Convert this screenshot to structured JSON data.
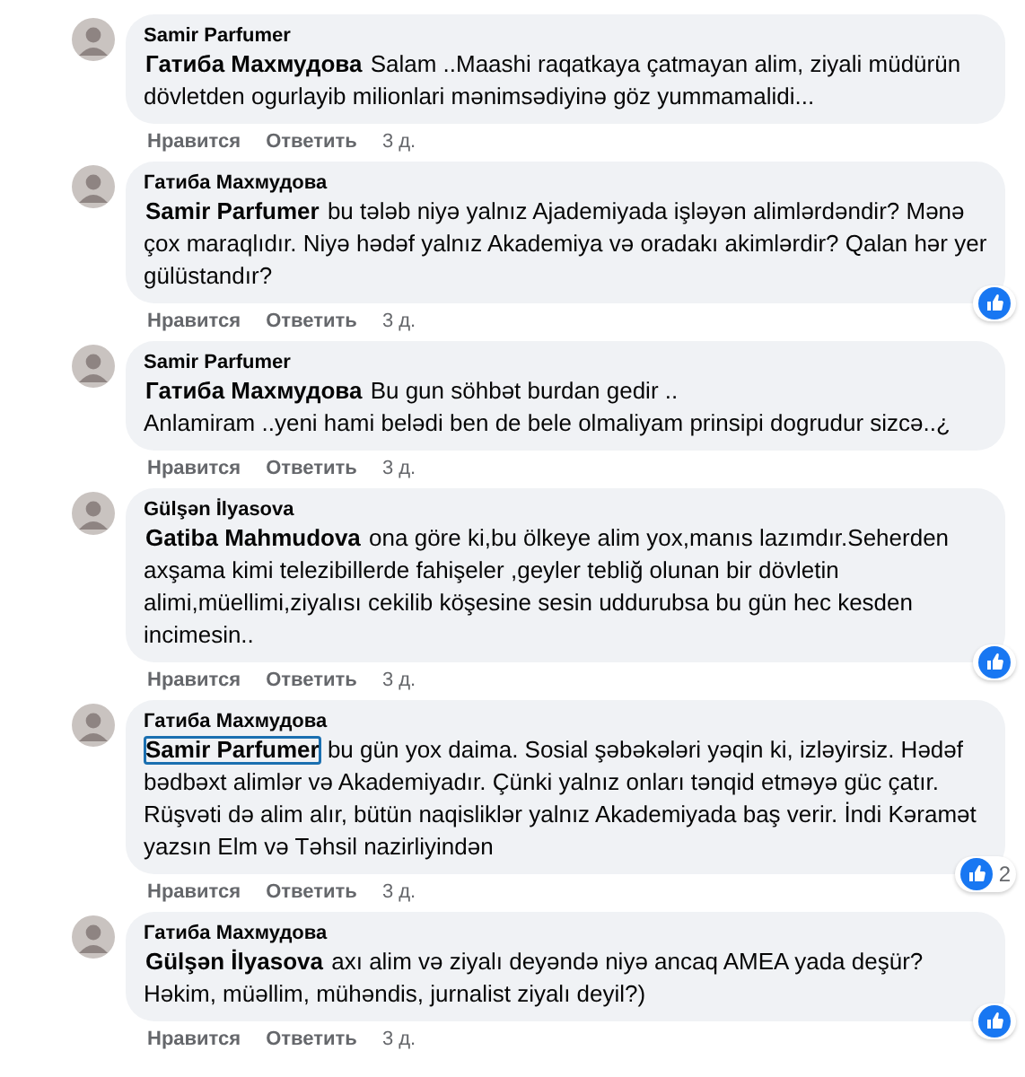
{
  "comments": [
    {
      "author": "Samir Parfumer",
      "mention": "Гатиба Махмудова",
      "mention_focused": false,
      "text": "Salam ..Maashi raqatkaya çatmayan alim, ziyali müdürün dövletden ogurlayib milionlari mənimsədiyinə göz yummamalidi...",
      "liked": false,
      "actions": [
        "Нравится",
        "Ответить"
      ],
      "time": "3 д."
    },
    {
      "author": "Гатиба Махмудова",
      "mention": "Samir Parfumer",
      "mention_focused": false,
      "text": "bu tələb niyə yalnız Ajademiyada işləyən alimlərdəndir? Mənə çox maraqlıdır. Niyə hədəf yalnız Akademiya və oradakı akimlərdir? Qalan hər yer gülüstandır?",
      "liked": true,
      "actions": [
        "Нравится",
        "Ответить"
      ],
      "time": "3 д."
    },
    {
      "author": "Samir Parfumer",
      "mention": "Гатиба Махмудова",
      "mention_focused": false,
      "text": "Bu gun söhbət burdan gedir ..\nAnlamiram ..yeni hami belədi ben de bele olmaliyam prinsipi dogrudur sizcə..¿",
      "liked": false,
      "actions": [
        "Нравится",
        "Ответить"
      ],
      "time": "3 д."
    },
    {
      "author": "Gülşən İlyasova",
      "mention": "Gatiba Mahmudova",
      "mention_focused": false,
      "text": "ona göre ki,bu ölkeye alim yox,manıs lazımdır.Seherden axşama kimi telezibillerde fahişeler ,geyler tebliğ olunan bir dövletin alimi,müellimi,ziyalısı cekilib köşesine sesin uddurubsa bu gün hec kesden incimesin..",
      "liked": true,
      "actions": [
        "Нравится",
        "Ответить"
      ],
      "time": "3 д."
    },
    {
      "author": "Гатиба Махмудова",
      "mention": "Samir Parfumer",
      "mention_focused": true,
      "text": "bu gün yox daima. Sosial şəbəkələri yəqin ki, izləyirsiz. Hədəf bədbəxt alimlər və Akademiyadır. Çünki yalnız onları tənqid etməyə güc çatır. Rüşvəti də alim alır, bütün naqisliklər yalnız Akademiyada baş verir. İndi Kəramət yazsın Elm və Təhsil nazirliyindən",
      "liked": true,
      "like_count": "2",
      "actions": [
        "Нравится",
        "Ответить"
      ],
      "time": "3 д."
    },
    {
      "author": "Гатиба Махмудова",
      "mention": "Gülşən İlyasova",
      "mention_focused": false,
      "text": "axı alim və ziyalı deyəndə niyə ancaq AMEA yada deşür?\nHəkim, müəllim, mühəndis, jurnalist ziyalı deyil?)",
      "liked": true,
      "actions": [
        "Нравится",
        "Ответить"
      ],
      "time": "3 д."
    }
  ]
}
